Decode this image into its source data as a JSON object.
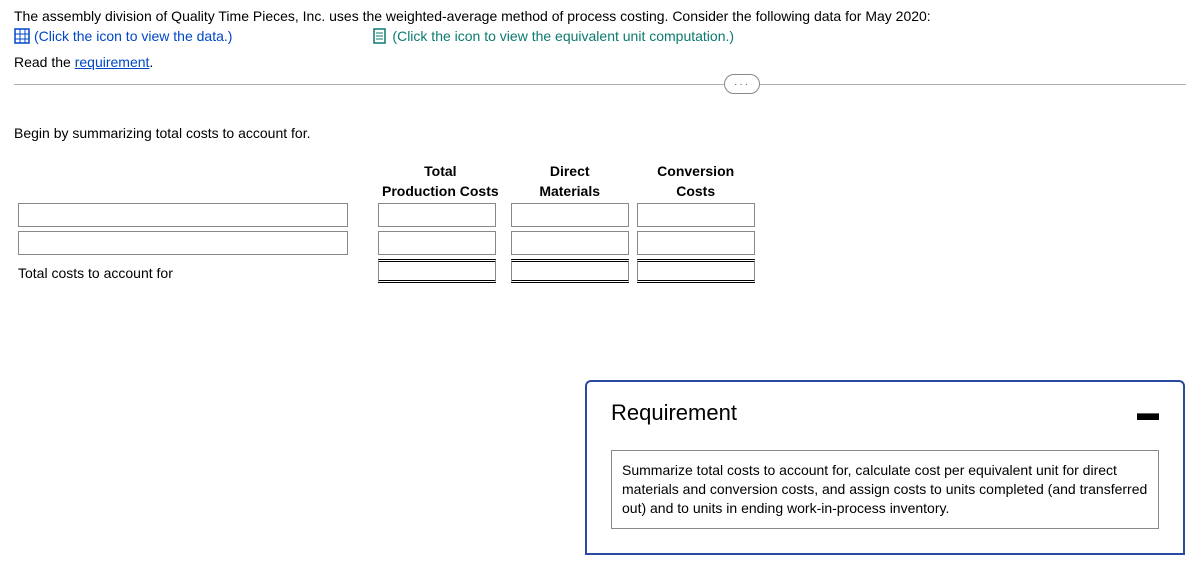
{
  "intro": "The assembly division of Quality Time Pieces, Inc. uses the weighted-average method of process costing. Consider the following data for May 2020:",
  "links": {
    "data_link": "(Click the icon to view the data.)",
    "eu_link": "(Click the icon to view the equivalent unit computation.)"
  },
  "read_req_prefix": "Read the ",
  "read_req_link": "requirement",
  "read_req_suffix": ".",
  "pill": "···",
  "instruction": "Begin by summarizing total costs to account for.",
  "table": {
    "headers": {
      "col1_line1": "Total",
      "col1_line2": "Production Costs",
      "col2_line1": "Direct",
      "col2_line2": "Materials",
      "col3_line1": "Conversion",
      "col3_line2": "Costs"
    },
    "total_label": "Total costs to account for"
  },
  "popup": {
    "title": "Requirement",
    "body": "Summarize total costs to account for, calculate cost per equivalent unit for direct materials and conversion costs, and assign costs to units completed (and transferred out) and to units in ending work-in-process inventory."
  }
}
